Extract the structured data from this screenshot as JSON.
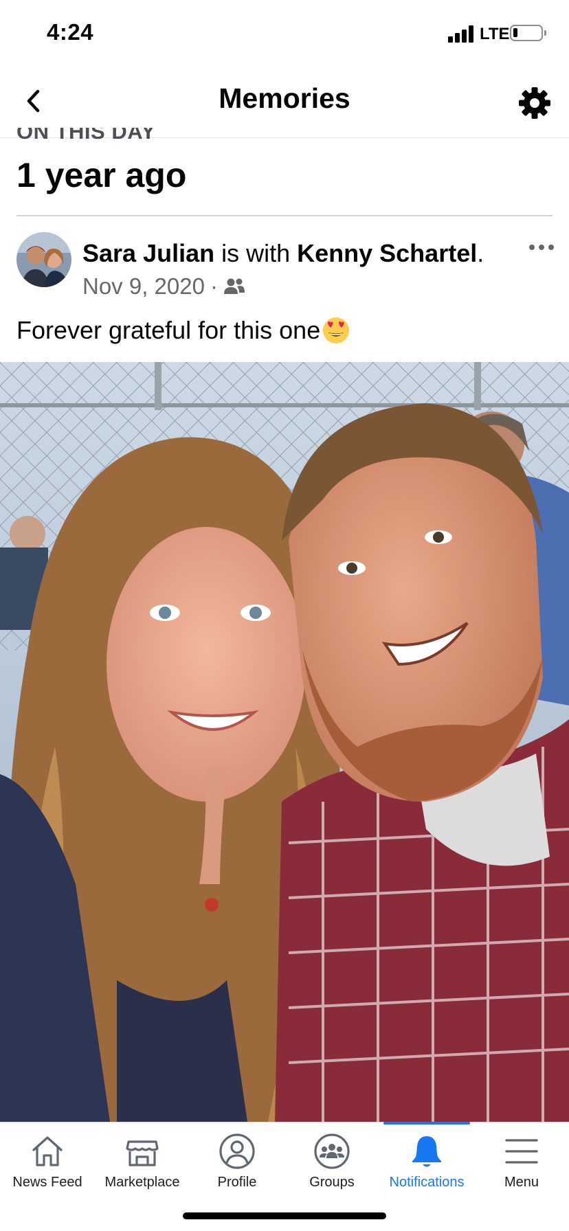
{
  "status_bar": {
    "time": "4:24",
    "network": "LTE",
    "battery_level_fraction": 0.12,
    "signal_bars": 4
  },
  "header": {
    "title": "Memories",
    "back_icon": "chevron-left-icon",
    "settings_icon": "gear-icon"
  },
  "memory": {
    "section_label": "ON THIS DAY",
    "years_ago": "1 year ago"
  },
  "post": {
    "author": "Sara Julian",
    "with_text": " is with ",
    "tagged": "Kenny Schartel",
    "end_punct": ".",
    "date": "Nov 9, 2020",
    "separator": "·",
    "audience_icon": "friends-icon",
    "more_icon": "more-horizontal-icon",
    "text": "Forever grateful for this one",
    "emoji": "heart-eyes-emoji",
    "photo": "selfie-photo"
  },
  "tabs": [
    {
      "label": "News Feed",
      "icon": "home-icon",
      "active": false
    },
    {
      "label": "Marketplace",
      "icon": "marketplace-icon",
      "active": false
    },
    {
      "label": "Profile",
      "icon": "profile-icon",
      "active": false
    },
    {
      "label": "Groups",
      "icon": "groups-icon",
      "active": false
    },
    {
      "label": "Notifications",
      "icon": "bell-icon",
      "active": true
    },
    {
      "label": "Menu",
      "icon": "menu-icon",
      "active": false
    }
  ],
  "colors": {
    "accent": "#1877f2",
    "text_primary": "#050505",
    "text_secondary": "#65676b"
  }
}
